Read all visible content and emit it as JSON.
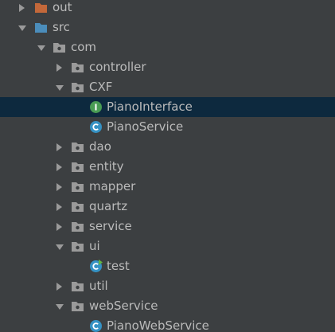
{
  "project_tree": {
    "nodes": [
      {
        "label": "out",
        "arrow": "right",
        "icon": "folder-orange-icon",
        "selected": false
      },
      {
        "label": "src",
        "arrow": "down",
        "icon": "source-folder-icon",
        "selected": false
      },
      {
        "label": "com",
        "arrow": "down",
        "icon": "package-icon",
        "selected": false
      },
      {
        "label": "controller",
        "arrow": "right",
        "icon": "package-icon",
        "selected": false
      },
      {
        "label": "CXF",
        "arrow": "down",
        "icon": "package-icon",
        "selected": false
      },
      {
        "label": "PianoInterface",
        "arrow": "",
        "icon": "interface-icon",
        "selected": true
      },
      {
        "label": "PianoService",
        "arrow": "",
        "icon": "class-icon",
        "selected": false
      },
      {
        "label": "dao",
        "arrow": "right",
        "icon": "package-icon",
        "selected": false
      },
      {
        "label": "entity",
        "arrow": "right",
        "icon": "package-icon",
        "selected": false
      },
      {
        "label": "mapper",
        "arrow": "right",
        "icon": "package-icon",
        "selected": false
      },
      {
        "label": "quartz",
        "arrow": "right",
        "icon": "package-icon",
        "selected": false
      },
      {
        "label": "service",
        "arrow": "right",
        "icon": "package-icon",
        "selected": false
      },
      {
        "label": "ui",
        "arrow": "down",
        "icon": "package-icon",
        "selected": false
      },
      {
        "label": "test",
        "arrow": "",
        "icon": "runnable-class-icon",
        "selected": false
      },
      {
        "label": "util",
        "arrow": "right",
        "icon": "package-icon",
        "selected": false
      },
      {
        "label": "webService",
        "arrow": "down",
        "icon": "package-icon",
        "selected": false
      },
      {
        "label": "PianoWebService",
        "arrow": "",
        "icon": "class-icon",
        "selected": false
      }
    ]
  },
  "colors": {
    "background": "#3c3f41",
    "selection": "#0d293e",
    "text": "#bbbbbb",
    "interface_badge": "#499c54",
    "class_badge": "#3592c4",
    "folder_orange": "#c3683a",
    "source_folder": "#4b8dbb",
    "package_folder": "#9a9a9a"
  }
}
